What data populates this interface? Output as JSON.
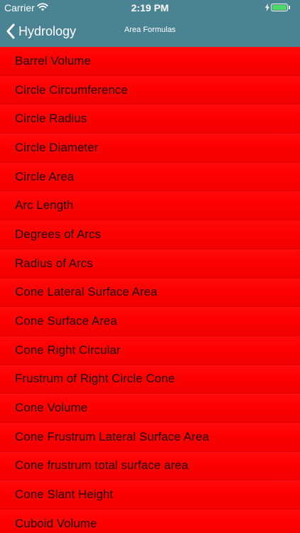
{
  "status_bar": {
    "carrier": "Carrier",
    "time": "2:19 PM",
    "battery_color": "#4cd964"
  },
  "nav_bar": {
    "back_label": "Hydrology",
    "title": "Area Formulas",
    "background_color": "#4a8393"
  },
  "list": {
    "background_color": "#ff0000",
    "items": [
      "Barrel Volume",
      "Circle Circumference",
      "Circle Radius",
      "Circle Diameter",
      "Circle Area",
      "Arc Length",
      "Degrees of Arcs",
      "Radius of Arcs",
      "Cone Lateral Surface Area",
      "Cone Surface Area",
      "Cone Right Circular",
      "Frustrum of Right Circle Cone",
      "Cone Volume",
      "Cone Frustrum Lateral Surface Area",
      "Cone frustrum total surface area",
      "Cone Slant Height",
      "Cuboid Volume"
    ]
  }
}
